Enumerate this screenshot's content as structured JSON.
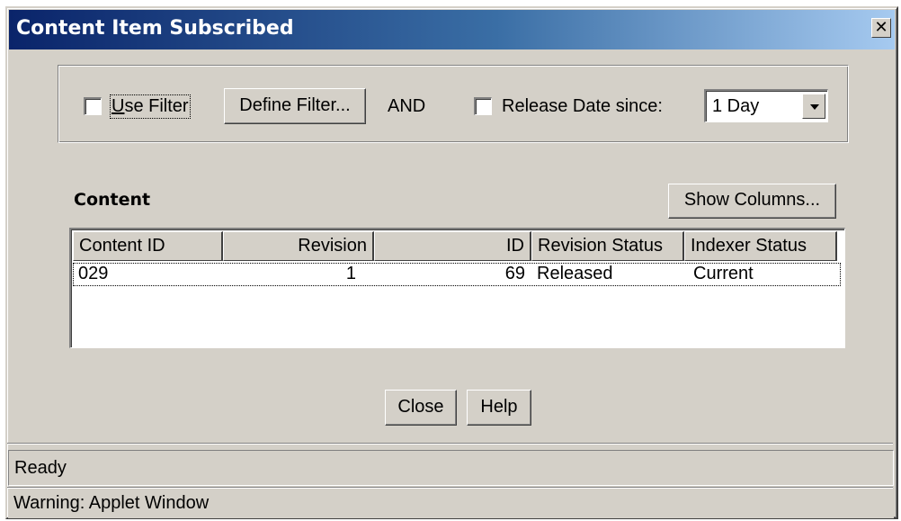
{
  "window": {
    "title": "Content Item Subscribed",
    "close_glyph": "✕"
  },
  "filter": {
    "use_filter_label": "Use Filter",
    "use_filter_checked": false,
    "define_filter_button": "Define Filter...",
    "and_label": "AND",
    "release_date_label": "Release Date since:",
    "release_date_checked": false,
    "release_date_value": "1 Day"
  },
  "content": {
    "heading": "Content",
    "show_columns_button": "Show Columns...",
    "columns": [
      "Content ID",
      "Revision",
      "ID",
      "Revision Status",
      "Indexer Status"
    ],
    "rows": [
      [
        "029",
        "1",
        "69",
        "Released",
        "Current"
      ]
    ]
  },
  "buttons": {
    "close": "Close",
    "help": "Help"
  },
  "status": {
    "text": "Ready",
    "warning": "Warning: Applet Window"
  }
}
